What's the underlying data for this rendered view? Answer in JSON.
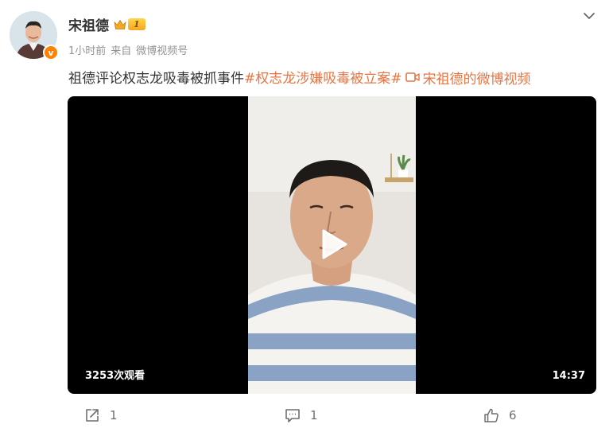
{
  "author": {
    "name": "宋祖德",
    "level": "1",
    "verified_mark": "v"
  },
  "meta": {
    "time": "1小时前",
    "source_prefix": "来自",
    "source": "微博视频号"
  },
  "post": {
    "text": "祖德评论权志龙吸毒被抓事件",
    "hashtag": "#权志龙涉嫌吸毒被立案#",
    "video_link": "宋祖德的微博视频"
  },
  "video": {
    "views": "3253次观看",
    "duration": "14:37"
  },
  "actions": {
    "repost_count": "1",
    "comment_count": "1",
    "like_count": "6"
  },
  "colors": {
    "accent": "#eb7340",
    "verified": "#ff8200",
    "meta_text": "#939393"
  }
}
